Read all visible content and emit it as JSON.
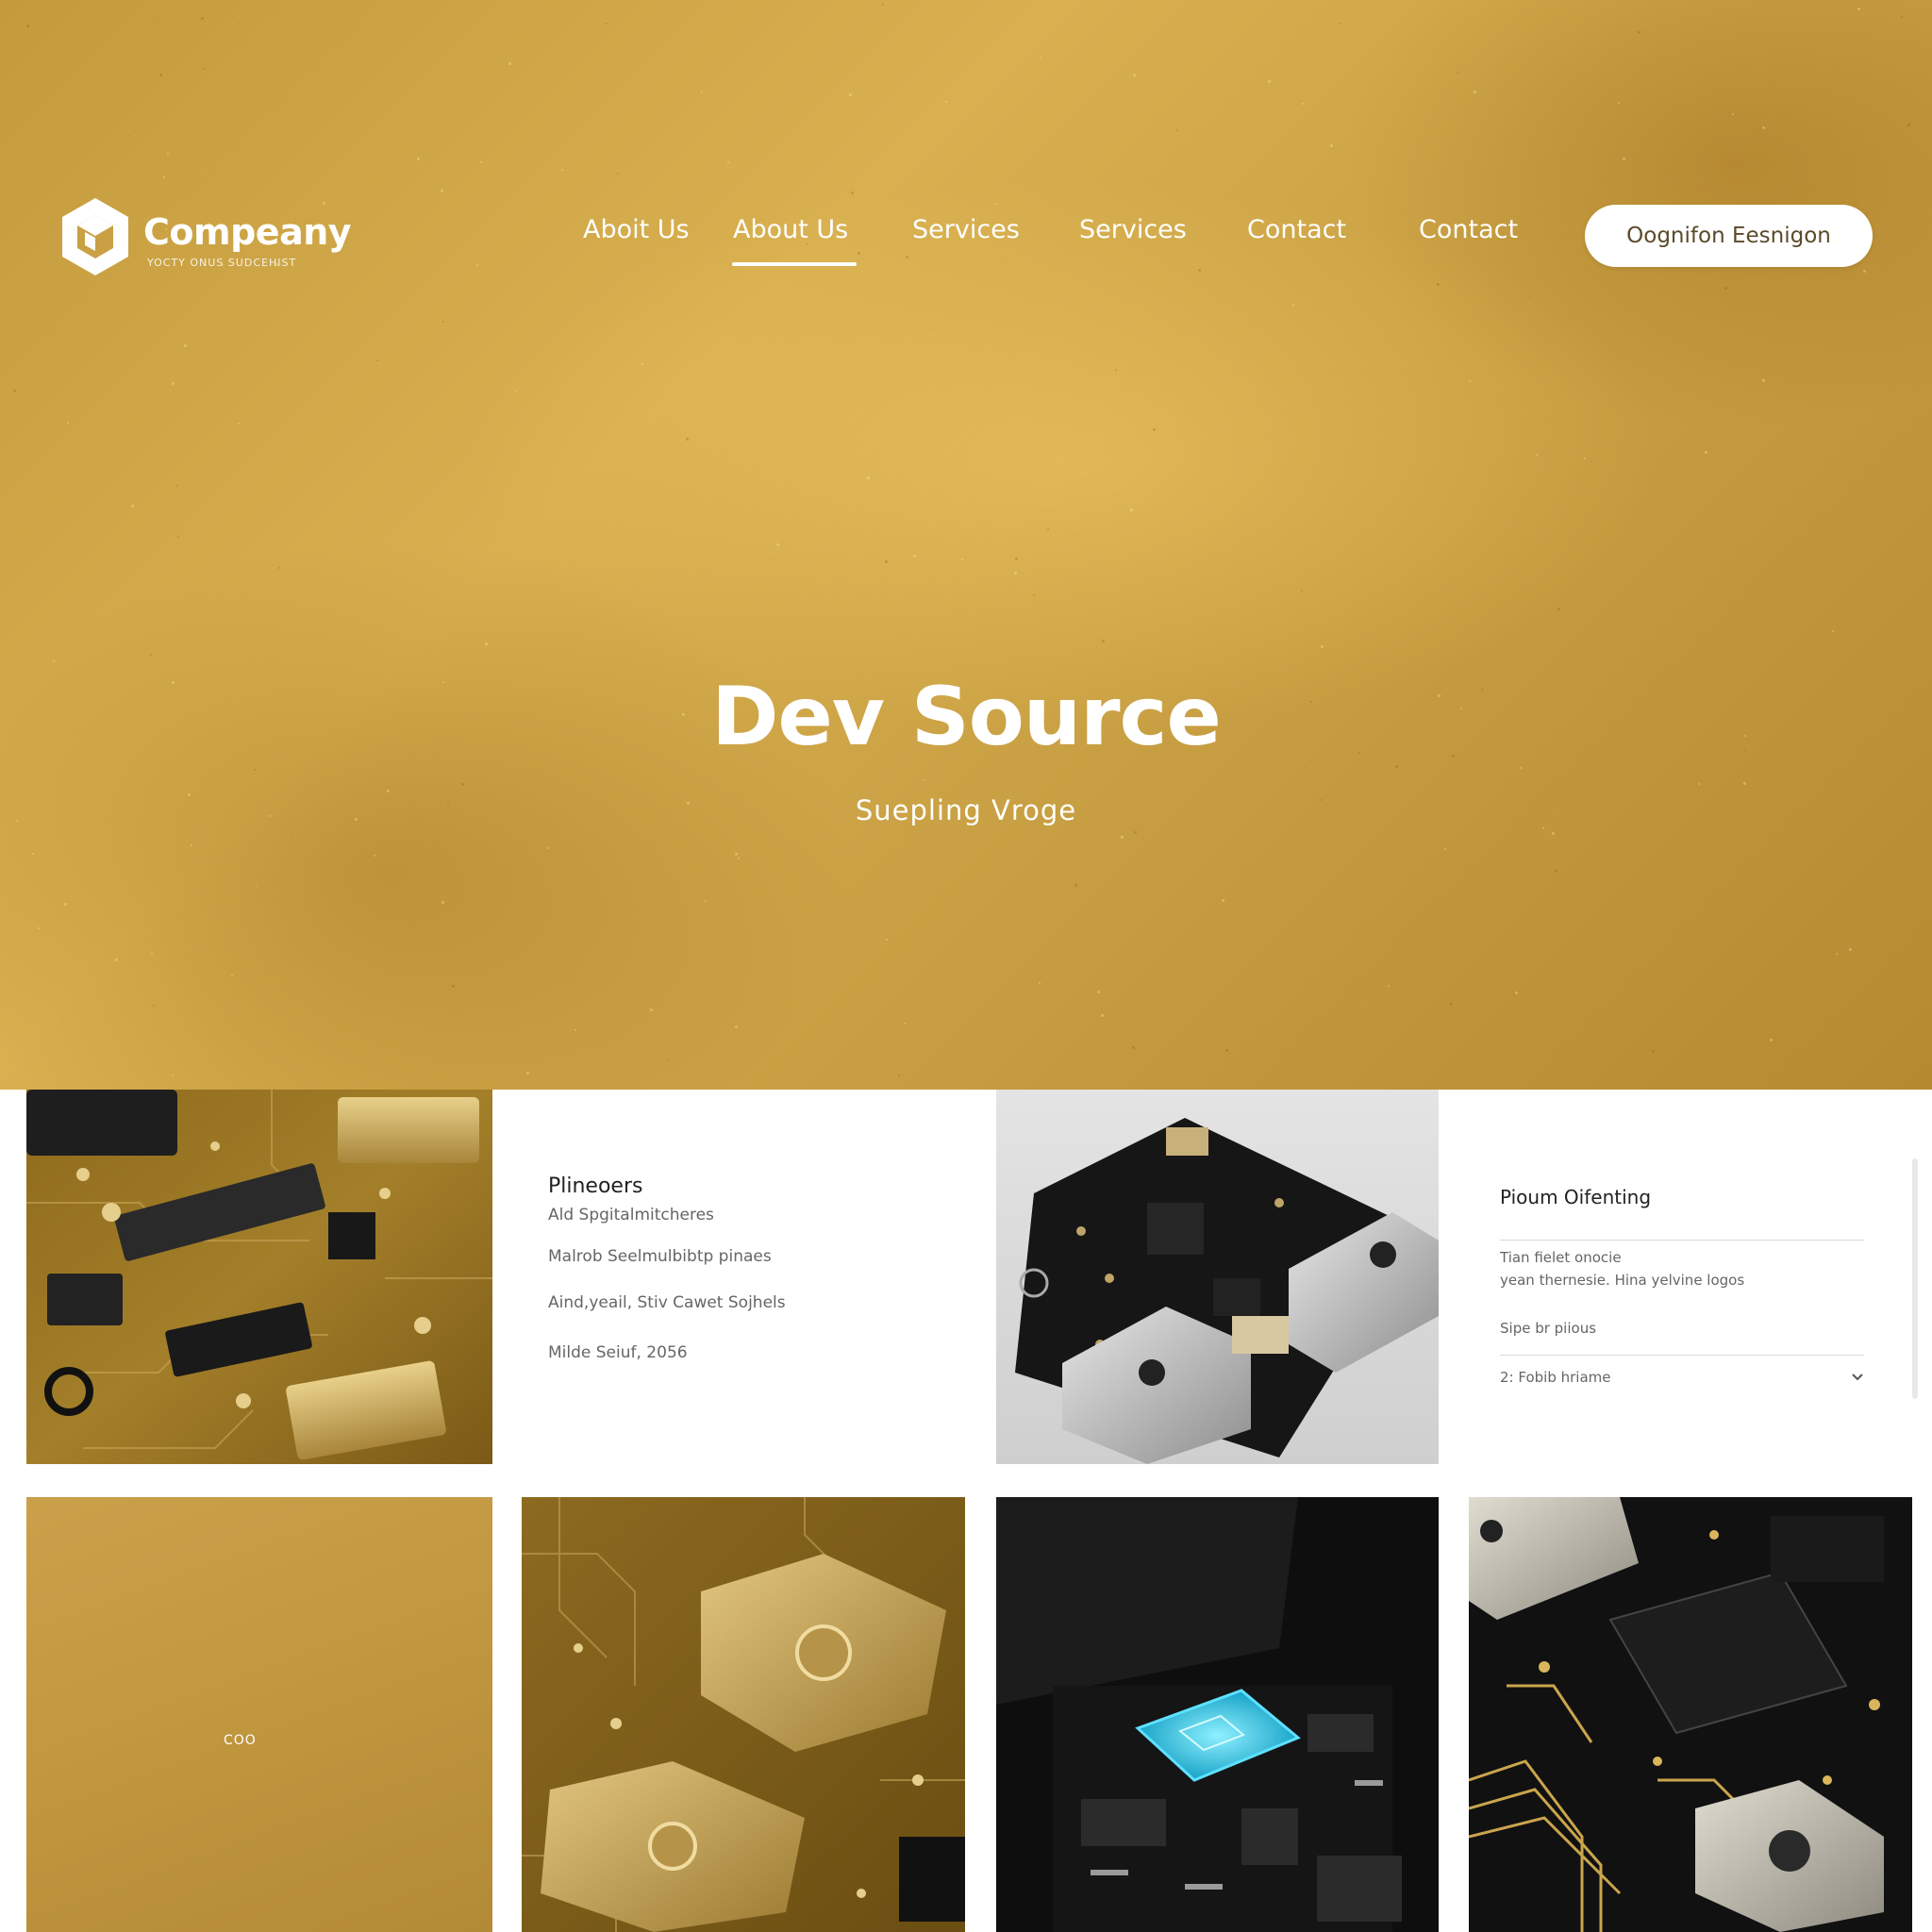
{
  "header": {
    "logo_name": "Compeany",
    "logo_tagline": "YOCTY ONUS SUDCEHIST",
    "nav": [
      {
        "label": "Aboit Us"
      },
      {
        "label": "About Us",
        "active": true
      },
      {
        "label": "Services"
      },
      {
        "label": "Services"
      },
      {
        "label": "Contact"
      },
      {
        "label": "Contact"
      }
    ],
    "cta_label": "Oognifon Eesnigon"
  },
  "hero": {
    "title": "Dev Source",
    "subtitle": "Suepling  Vroge"
  },
  "cards": {
    "first": {
      "title": "Plineoers",
      "lines": [
        "Ald Spgitalmitcheres",
        "Malrob Seelmulbibtp pinaes",
        "Aind,yeail, Stiv Cawet Sojhels",
        "Milde Seiuf, 2056"
      ]
    },
    "second": {
      "title": "Pioum Oifenting",
      "desc_line1": "Tian fielet onocie",
      "desc_line2": "yean thernesie. Hina yelvine logos",
      "meta": "Sipe br piious",
      "select_value": "2: Fobib hriame"
    },
    "yellow_tile_label": "COO"
  },
  "colors": {
    "gold": "#c9a043",
    "gold_light": "#e0bb5a",
    "pcb_black": "#141414",
    "chip_cyan": "#29c6e8"
  },
  "icons": {
    "logo": "hexagon-cube-logo-icon",
    "dropdown": "chevron-down-icon"
  }
}
